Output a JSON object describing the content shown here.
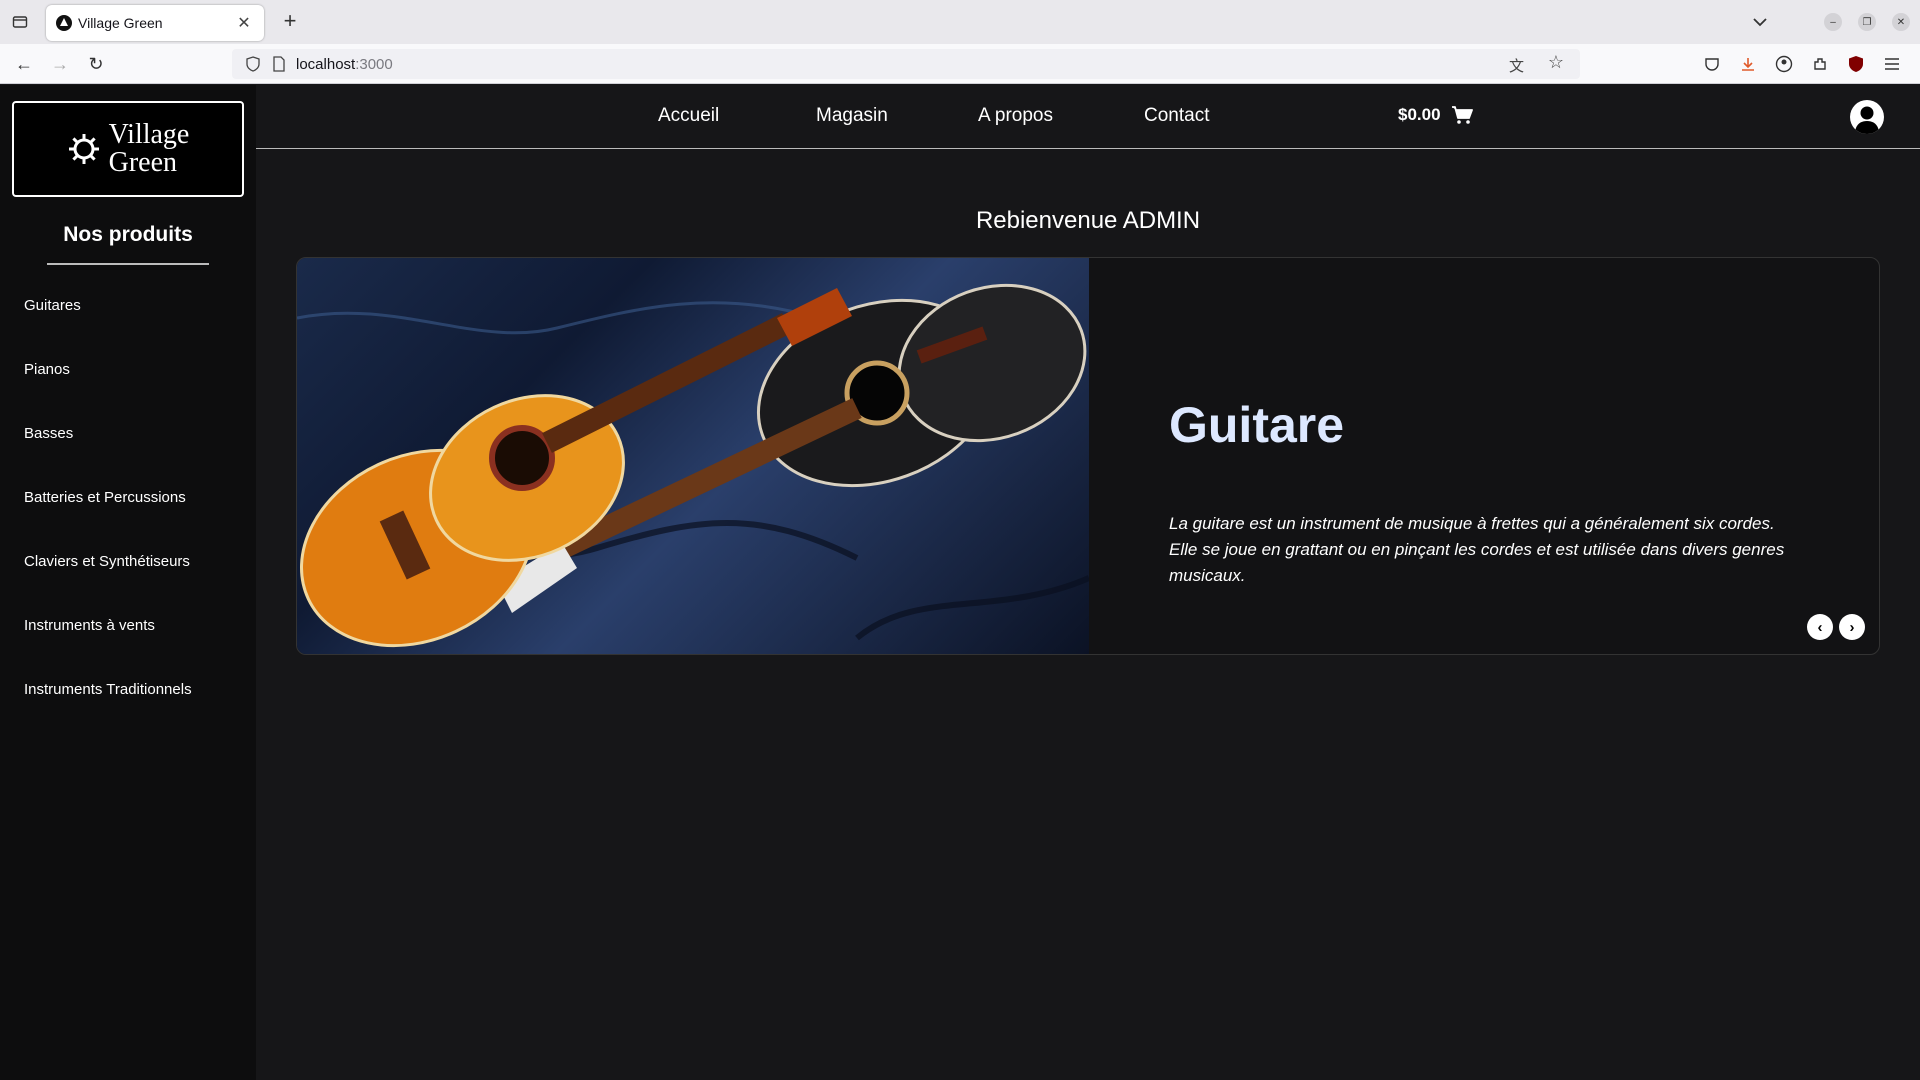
{
  "browser": {
    "tab_title": "Village Green",
    "url_host": "localhost",
    "url_port": ":3000"
  },
  "logo": {
    "line1": "Village",
    "line2": "Green"
  },
  "sidebar": {
    "title": "Nos produits",
    "items": [
      {
        "label": "Guitares"
      },
      {
        "label": "Pianos"
      },
      {
        "label": "Basses"
      },
      {
        "label": "Batteries et Percussions"
      },
      {
        "label": "Claviers et Synthétiseurs"
      },
      {
        "label": "Instruments à vents"
      },
      {
        "label": "Instruments Traditionnels"
      }
    ]
  },
  "header": {
    "menu": [
      {
        "label": "Accueil"
      },
      {
        "label": "Magasin"
      },
      {
        "label": "A propos"
      },
      {
        "label": "Contact"
      }
    ],
    "cart_total": "$0.00"
  },
  "welcome": "Rebienvenue ADMIN",
  "carousel": {
    "title": "Guitare",
    "description": "La guitare est un instrument de musique à frettes qui a généralement six cordes. Elle se joue en grattant ou en pinçant les cordes et est utilisée dans divers genres musicaux."
  }
}
